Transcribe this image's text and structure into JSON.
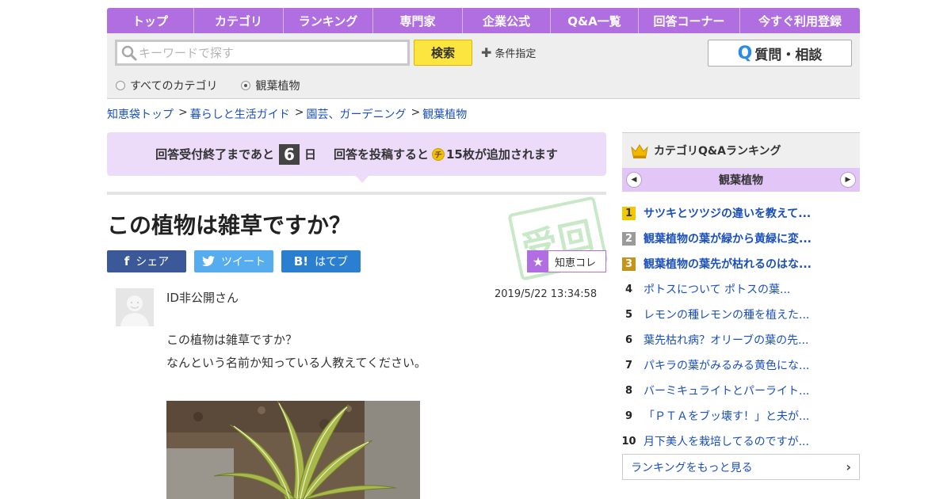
{
  "nav": {
    "items": [
      "トップ",
      "カテゴリ",
      "ランキング",
      "専門家",
      "企業公式",
      "Q&A一覧",
      "回答コーナー",
      "今すぐ利用登録"
    ]
  },
  "search": {
    "placeholder": "キーワードで探す",
    "button_label": "検索",
    "condition_label": "条件指定",
    "ask_button_label": "質問・相談",
    "scope_all": "すべてのカテゴリ",
    "scope_current": "観葉植物",
    "selected_scope": "観葉植物"
  },
  "breadcrumb": [
    "知恵袋トップ",
    "暮らしと生活ガイド",
    "園芸、ガーデニング",
    "観葉植物"
  ],
  "notice": {
    "prefix": "回答受付終了まであと",
    "days": "6",
    "day_unit": "日",
    "reward_text": "回答を投稿すると",
    "coin_glyph": "チ",
    "reward_suffix": "15枚が追加されます"
  },
  "question": {
    "title": "この植物は雑草ですか？",
    "stamp_text": "受回",
    "share_facebook": "シェア",
    "share_twitter": "ツイート",
    "share_hatena": "はてブ",
    "hatena_icon": "B!",
    "chie_label": "知恵コレ",
    "user": "ID非公開さん",
    "posted_at": "2019/5/22  13:34:58",
    "body_lines": [
      "この植物は雑草ですか？",
      "なんという名前か知っている人教えてください。"
    ]
  },
  "ranking": {
    "title": "カテゴリQ&Aランキング",
    "category": "観葉植物",
    "items": [
      {
        "rank": "1",
        "text": "サツキとツツジの違いを教えて..."
      },
      {
        "rank": "2",
        "text": "観葉植物の葉が緑から黄緑に変..."
      },
      {
        "rank": "3",
        "text": "観葉植物の葉先が枯れるのはな..."
      },
      {
        "rank": "4",
        "text": "ポトスについて ポトスの葉..."
      },
      {
        "rank": "5",
        "text": "レモンの種レモンの種を植えた..."
      },
      {
        "rank": "6",
        "text": "葉先枯れ病？オリーブの葉の先..."
      },
      {
        "rank": "7",
        "text": "パキラの葉がみるみる黄色にな..."
      },
      {
        "rank": "8",
        "text": "バーミキュライトとパーライト..."
      },
      {
        "rank": "9",
        "text": "「ＰＴＡをブッ壊す！」と夫が..."
      },
      {
        "rank": "10",
        "text": "月下美人を栽培してるのですが..."
      }
    ],
    "more_label": "ランキングをもっと見る"
  }
}
